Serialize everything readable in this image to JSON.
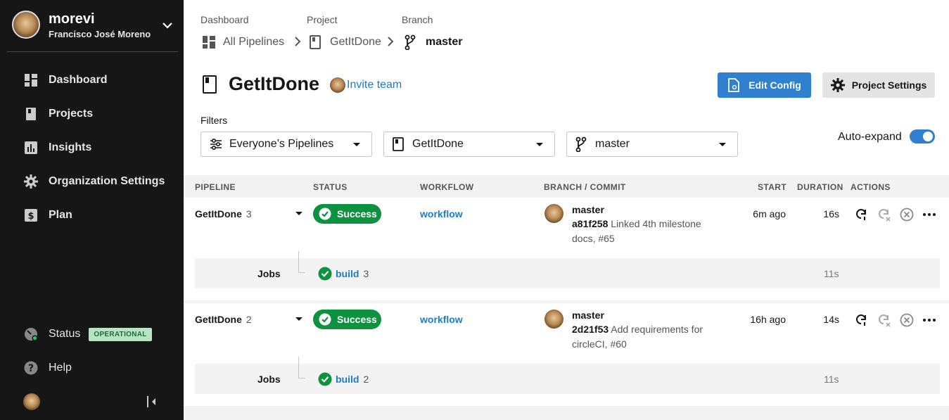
{
  "org": {
    "name": "morevi",
    "user": "Francisco José Moreno"
  },
  "nav": {
    "items": [
      {
        "label": "Dashboard",
        "icon": "dashboard-icon"
      },
      {
        "label": "Projects",
        "icon": "projects-icon"
      },
      {
        "label": "Insights",
        "icon": "insights-icon"
      },
      {
        "label": "Organization Settings",
        "icon": "gear-icon"
      },
      {
        "label": "Plan",
        "icon": "plan-icon"
      }
    ],
    "status_label": "Status",
    "status_badge": "OPERATIONAL",
    "help_label": "Help"
  },
  "breadcrumb": {
    "labels": [
      "Dashboard",
      "Project",
      "Branch"
    ],
    "items": [
      "All Pipelines",
      "GetItDone",
      "master"
    ]
  },
  "project": {
    "title": "GetItDone",
    "invite_label": "Invite team"
  },
  "buttons": {
    "edit_config": "Edit Config",
    "project_settings": "Project Settings"
  },
  "filters": {
    "label": "Filters",
    "pipelines": "Everyone’s Pipelines",
    "project": "GetItDone",
    "branch": "master",
    "auto_expand_label": "Auto-expand",
    "auto_expand_on": true
  },
  "table": {
    "headers": [
      "PIPELINE",
      "STATUS",
      "WORKFLOW",
      "BRANCH / COMMIT",
      "START",
      "DURATION",
      "ACTIONS"
    ],
    "jobs_label": "Jobs",
    "rows": [
      {
        "pipeline": "GetItDone",
        "number": "3",
        "status": "Success",
        "workflow": "workflow",
        "branch": "master",
        "sha": "a81f258",
        "message": "Linked 4th milestone docs, #65",
        "start": "6m ago",
        "duration": "16s",
        "job_name": "build",
        "job_number": "3",
        "job_duration": "11s"
      },
      {
        "pipeline": "GetItDone",
        "number": "2",
        "status": "Success",
        "workflow": "workflow",
        "branch": "master",
        "sha": "2d21f53",
        "message": "Add requirements for circleCI, #60",
        "start": "16h ago",
        "duration": "14s",
        "job_name": "build",
        "job_number": "2",
        "job_duration": "11s"
      }
    ]
  },
  "colors": {
    "accent": "#3080d0",
    "success": "#0d9240",
    "sidebar": "#161616",
    "link": "#1e7bc6"
  }
}
